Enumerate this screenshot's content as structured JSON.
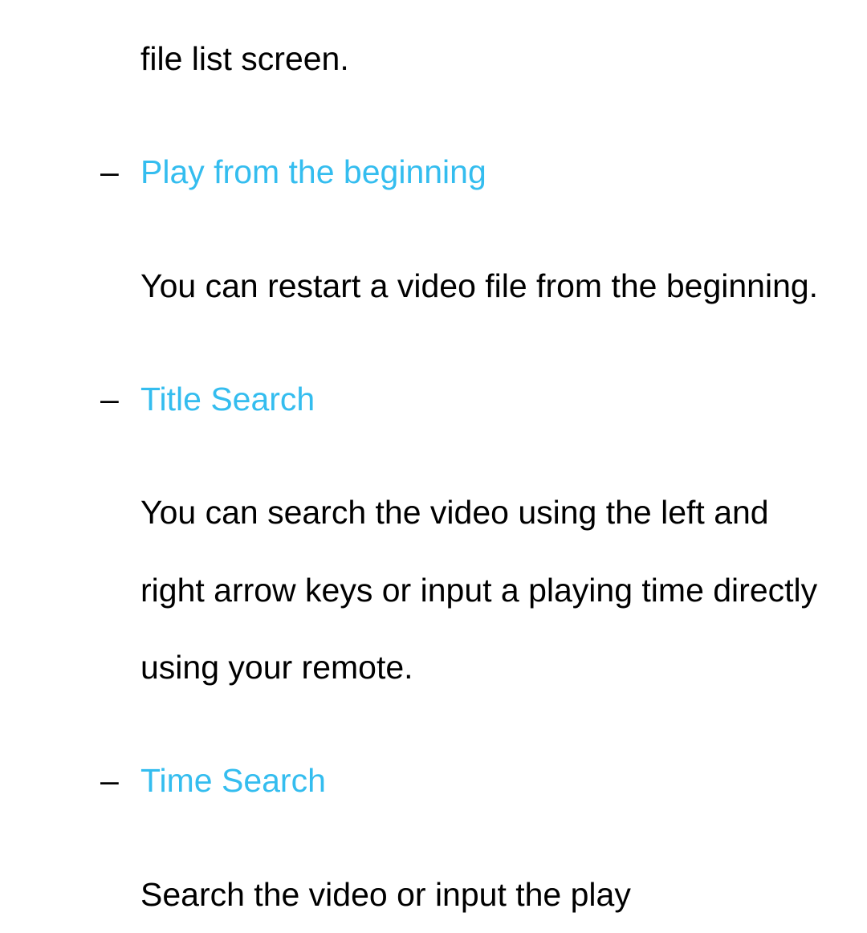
{
  "fragment_top": "file list screen.",
  "items": [
    {
      "title": "Play from the beginning",
      "desc": "You can restart a video file from the beginning."
    },
    {
      "title": "Title Search",
      "desc": "You can search the video using the left and right arrow keys or input a playing time directly using your remote."
    },
    {
      "title": "Time Search",
      "desc": "Search the video or input the play"
    }
  ],
  "dash": "–"
}
